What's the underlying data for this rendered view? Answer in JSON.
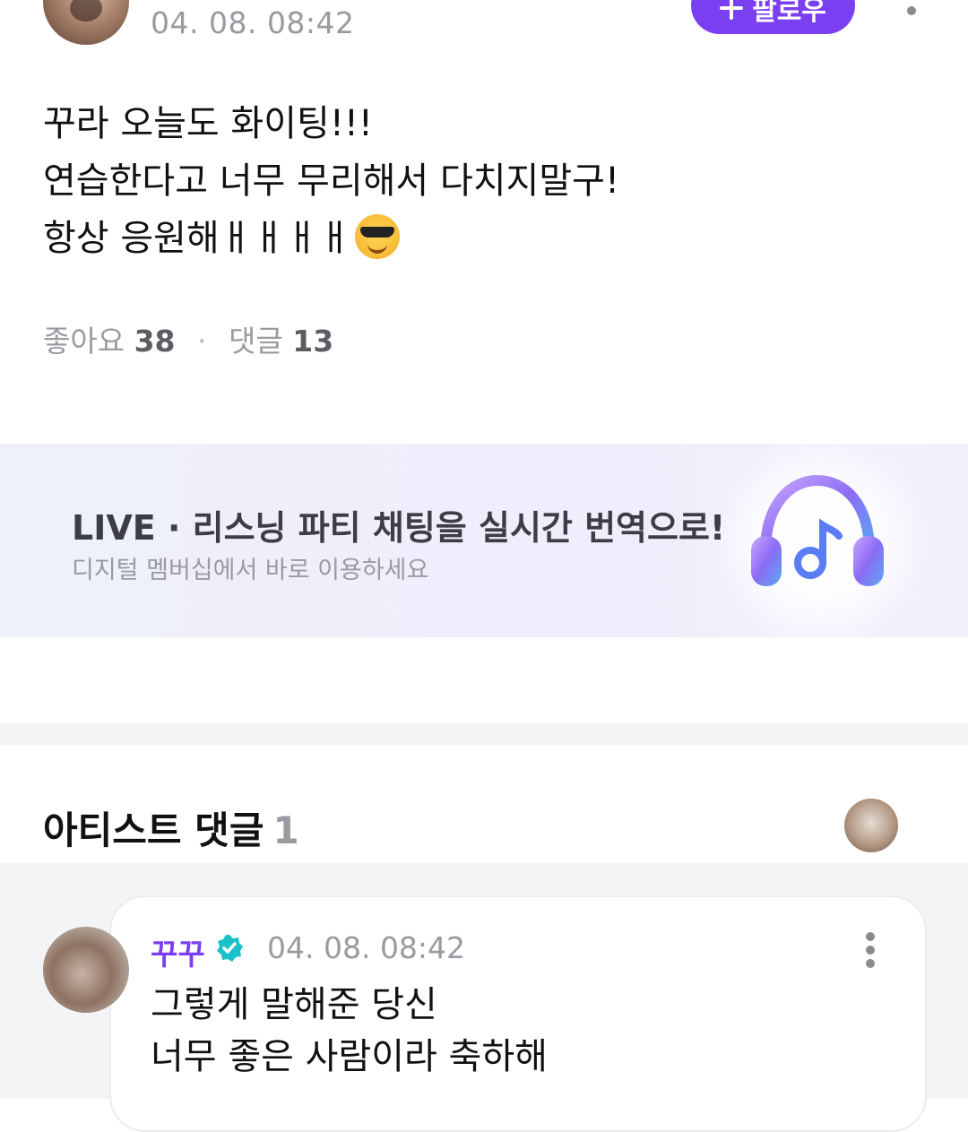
{
  "post": {
    "date": "04. 08. 08:42",
    "follow_label": "팔로우",
    "body_lines": [
      "꾸라 오늘도 화이팅!!!",
      "연습한다고 너무 무리해서 다치지말구!",
      "항상 응원해ㅐㅐㅐㅐ"
    ],
    "likes_label": "좋아요",
    "likes_count": "38",
    "comments_label": "댓글",
    "comments_count": "13"
  },
  "banner": {
    "title": "LIVE · 리스닝 파티 채팅을 실시간 번역으로!",
    "subtitle": "디지털 멤버십에서 바로 이용하세요"
  },
  "artist_comments": {
    "title": "아티스트 댓글",
    "count": "1",
    "comment": {
      "author": "꾸꾸",
      "date": "04. 08. 08:42",
      "lines": [
        "그렇게 말해준 당신",
        "너무 좋은 사람이라 축하해"
      ]
    }
  },
  "colors": {
    "accent": "#7b3ff2",
    "verified": "#19c1c9",
    "muted_text": "#9a9aa0",
    "banner_bg": "#eef0fb"
  },
  "icons": [
    "plus-icon",
    "kebab-menu-icon",
    "sunglasses-emoji-icon",
    "headphones-music-icon",
    "verified-badge-icon"
  ]
}
